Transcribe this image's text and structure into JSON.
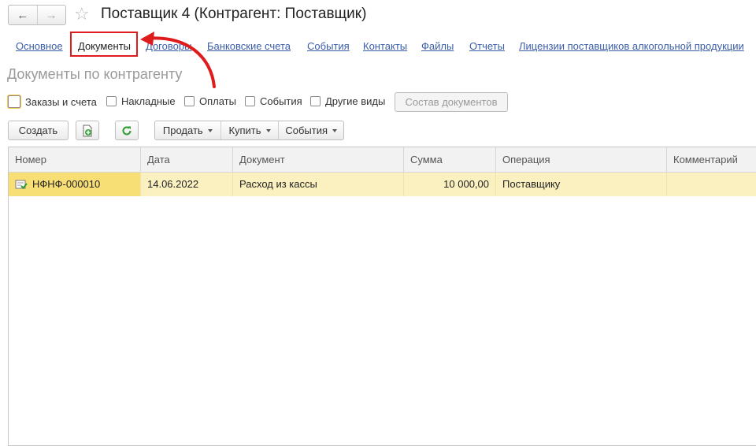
{
  "window": {
    "back_icon": "arrow-left-icon",
    "forward_icon": "arrow-right-icon",
    "favorite_icon": "star-icon",
    "title": "Поставщик 4 (Контрагент: Поставщик)"
  },
  "tabs": [
    {
      "label": "Основное"
    },
    {
      "label": "Документы",
      "active": true
    },
    {
      "label": "Договоры"
    },
    {
      "label": "Банковские счета"
    },
    {
      "label": "События"
    },
    {
      "label": "Контакты"
    },
    {
      "label": "Файлы"
    },
    {
      "label": "Отчеты"
    },
    {
      "label": "Лицензии поставщиков алкогольной продукции"
    }
  ],
  "section_title": "Документы по контрагенту",
  "filters": [
    {
      "label": "Заказы и счета",
      "checked": false
    },
    {
      "label": "Накладные",
      "checked": false
    },
    {
      "label": "Оплаты",
      "checked": false
    },
    {
      "label": "События",
      "checked": false
    },
    {
      "label": "Другие виды",
      "checked": false
    }
  ],
  "composition_button": "Состав документов",
  "toolbar": {
    "create": "Создать",
    "add_icon": "add-document-icon",
    "refresh_icon": "refresh-icon",
    "sell": "Продать",
    "buy": "Купить",
    "events": "События"
  },
  "table": {
    "columns": [
      "Номер",
      "Дата",
      "Документ",
      "Сумма",
      "Операция",
      "Комментарий"
    ],
    "rows": [
      {
        "number": "НФНФ-000010",
        "date": "14.06.2022",
        "document": "Расход из кассы",
        "sum": "10 000,00",
        "operation": "Поставщику",
        "comment": "",
        "status_icon": "posted-document-icon"
      }
    ]
  },
  "colors": {
    "accent_link": "#3b5ea8",
    "highlight_red": "#e01b1b",
    "selected_row": "#fbf0c0"
  }
}
